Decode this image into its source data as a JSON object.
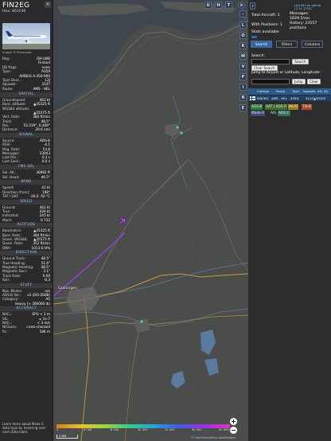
{
  "aircraft": {
    "callsign": "FIN2EG",
    "hex_line": "Hex:  461F49",
    "photo_credit": "Image © Planespot",
    "close_icon": "×"
  },
  "info_rows": [
    {
      "k": "Reg.:",
      "v": "OH-LWB"
    },
    {
      "k": "",
      "v": "Finland"
    },
    {
      "k": "DB flags:",
      "v": "none"
    },
    {
      "k": "Type:",
      "v": "A359"
    },
    {
      "k": "",
      "v": "AIRBUS A-350-900"
    },
    {
      "k": "Type Desc.:",
      "v": "L2J"
    },
    {
      "k": "Squawk:",
      "v": "3147"
    },
    {
      "k": "Route:",
      "v": "AMS - HEL"
    }
  ],
  "sections": [
    {
      "title": "SPATIAL",
      "rows": [
        {
          "k": "Groundspeed:",
          "v": "462 kt"
        },
        {
          "k": "Baro. altitude:",
          "v": "▲35325 ft"
        },
        {
          "k": "WGS84 altitude:",
          "v": ""
        },
        {
          "k": "",
          "v": "▲35575 ft"
        },
        {
          "k": "Vert. Rate:",
          "v": "384 ft/min"
        },
        {
          "k": "Track:",
          "v": "48.5°"
        },
        {
          "k": "Pos.:",
          "v": "53.319°, 6.489°"
        },
        {
          "k": "Distance:",
          "v": "29.6 nmi"
        }
      ]
    },
    {
      "title": "SIGNAL",
      "rows": [
        {
          "k": "Source:",
          "v": "ADS-B"
        },
        {
          "k": "RSSI:",
          "v": "-4.1"
        },
        {
          "k": "Msg. Rate:",
          "v": "53.6"
        },
        {
          "k": "Messages:",
          "v": "23043"
        },
        {
          "k": "Last Pos.:",
          "v": "0.3 s"
        },
        {
          "k": "Last Seen:",
          "v": "0.0 s"
        }
      ]
    },
    {
      "title": "FMS SEL",
      "rows": [
        {
          "k": "Sel. Alt.:",
          "v": "36992 ft"
        },
        {
          "k": "Sel. Head.:",
          "v": "46.5°"
        }
      ]
    },
    {
      "title": "WIND",
      "rows": [
        {
          "k": "Speed:",
          "v": "43 kt"
        },
        {
          "k": "Direction (from):",
          "v": "198°"
        },
        {
          "k": "TAT / OAT:",
          "v": "-26.0 -50 °C"
        }
      ]
    },
    {
      "title": "SPEED",
      "rows": [
        {
          "k": "Ground:",
          "v": "462 kt"
        },
        {
          "k": "True:",
          "v": "426 kt"
        },
        {
          "k": "Indicated:",
          "v": "245 kt"
        },
        {
          "k": "Mach:",
          "v": "0.732"
        }
      ]
    },
    {
      "title": "ALTITUDE",
      "rows": [
        {
          "k": "Barometric:",
          "v": "▲35325 ft"
        },
        {
          "k": "Baro. Rate:",
          "v": "384 ft/min"
        },
        {
          "k": "Geom. WGS84:",
          "v": "▲35575 ft"
        },
        {
          "k": "Geom. Rate:",
          "v": "352 ft/min"
        },
        {
          "k": "QNH:",
          "v": "1013.6 hPa"
        }
      ]
    },
    {
      "title": "DIRECTION",
      "rows": [
        {
          "k": "Ground Track:",
          "v": "48.5°"
        },
        {
          "k": "True Heading:",
          "v": "51.6°"
        },
        {
          "k": "Magnetic Heading:",
          "v": "48.5°"
        },
        {
          "k": "Magnetic Decl.:",
          "v": "3.1°"
        },
        {
          "k": "Track Rate:",
          "v": "0.00"
        },
        {
          "k": "Roll:",
          "v": "-0.3"
        }
      ]
    },
    {
      "title": "STUFF",
      "rows": [
        {
          "k": "Nav. Modes:",
          "v": "n/a"
        },
        {
          "k": "ADS-B Ver.:",
          "v": "v2 (DO-260B)"
        },
        {
          "k": "Category:",
          "v": "A5"
        },
        {
          "k": "",
          "v": "Heavy (> 300000 lb)"
        }
      ]
    },
    {
      "title": "ACCURACY",
      "rows": [
        {
          "k": "NACₚ:",
          "v": "EPU < 3 m"
        },
        {
          "k": "SIL:",
          "v": "≤ 1e-7"
        },
        {
          "k": "NACᵥ:",
          "v": "< 3 m/s"
        },
        {
          "k": "NICbaro:",
          "v": "cross-checked"
        },
        {
          "k": "Rc:",
          "v": "186 m"
        }
      ]
    }
  ],
  "footer_note": {
    "text": "Learn more about Mode S data type by hovering over each data label.",
    "link": "Mode S"
  },
  "map_buttons": {
    "top": [
      "U",
      "H",
      "T"
    ],
    "side": [
      "L",
      "O",
      "K",
      "M",
      "V",
      "P",
      "I",
      "R",
      "E"
    ],
    "arrow_left": "‹",
    "arrow_right": "›",
    "settings_icon": "gear-icon"
  },
  "legend": {
    "labels": [
      "0",
      "6 000",
      "8 000",
      "10 000",
      "20 000",
      "30 000",
      "40 000+"
    ]
  },
  "scale_label": "2 NM",
  "attribution": {
    "prefix": "© ",
    "link": "OpenStreetMap",
    "suffix": " contributors."
  },
  "map_labels": {
    "city": "Groningen"
  },
  "right": {
    "github": "tar1090 on github (3.14.1702)",
    "total_aircraft": "Total Aircraft: 1",
    "with_positions": "With Positions: 1",
    "stats_available": "Stats available",
    "messages": "Messages: 1629.5/sec",
    "history": "History: 23557 positions",
    "tabs": [
      "Search",
      "Filters",
      "Columns"
    ],
    "search_label": "Search:",
    "search_button": "Search",
    "clear_search_button": "Clear Search",
    "jump_label": "Jump to Airport or Latitude, Longitude:",
    "jump_button": "Jump",
    "clear_button": "Clear",
    "table_headers": [
      "Callsign",
      "Route",
      "Type",
      "Squawk",
      "Alt. (ft)"
    ],
    "table_row": {
      "flag": "🇫🇮",
      "callsign": "FIN2EG",
      "route": "AMS - HEL",
      "type": "A359",
      "squawk": "3147",
      "alt": "▲35325"
    },
    "sources": [
      {
        "label": "ADS-B",
        "color": "#2f7a3b"
      },
      {
        "label": "UAT / ADS-R",
        "color": "#3d6e2a"
      },
      {
        "label": "MLAT",
        "color": "#9a7a1a"
      },
      {
        "label": "TIS-B",
        "color": "#b0482e"
      },
      {
        "label": "Mode-S",
        "color": "#3a4a7a"
      },
      {
        "label": "AIS",
        "color": "#2a2a2a"
      },
      {
        "label": "ADS-C",
        "color": "#2d6d63"
      }
    ]
  },
  "colors": {
    "accent": "#8ec6ff",
    "track": "#9c3cf0",
    "panel_bg": "#2a2a2a"
  }
}
